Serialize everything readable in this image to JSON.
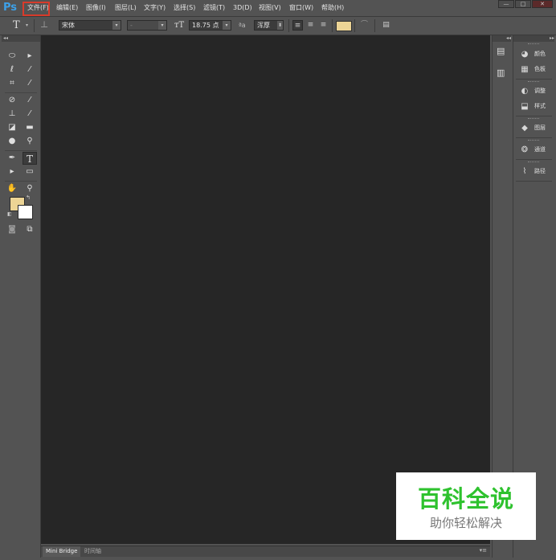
{
  "app": {
    "logo": "Ps"
  },
  "menu": [
    {
      "name": "menu-file",
      "label": "文件(F)"
    },
    {
      "name": "menu-edit",
      "label": "编辑(E)"
    },
    {
      "name": "menu-image",
      "label": "图像(I)"
    },
    {
      "name": "menu-layer",
      "label": "图层(L)"
    },
    {
      "name": "menu-type",
      "label": "文字(Y)"
    },
    {
      "name": "menu-select",
      "label": "选择(S)"
    },
    {
      "name": "menu-filter",
      "label": "滤镜(T)"
    },
    {
      "name": "menu-3d",
      "label": "3D(D)"
    },
    {
      "name": "menu-view",
      "label": "视图(V)"
    },
    {
      "name": "menu-window",
      "label": "窗口(W)"
    },
    {
      "name": "menu-help",
      "label": "帮助(H)"
    }
  ],
  "window_controls": {
    "minimize": "—",
    "maximize": "□",
    "close": "✕"
  },
  "options": {
    "font_family": "宋体",
    "font_style": "-",
    "font_size": "18.75 点",
    "antialias_label": "ªa",
    "antialias": "浑厚",
    "text_color": "#ecd495"
  },
  "tools": {
    "foreground_color": "#ecd495",
    "background_color": "#ffffff"
  },
  "canvas": {
    "background": "#262626"
  },
  "bottom_tabs": [
    {
      "label": "Mini Bridge"
    },
    {
      "label": "时间轴"
    }
  ],
  "panels": [
    {
      "name": "panel-color",
      "label": "颜色",
      "icon": "palette-icon"
    },
    {
      "name": "panel-swatches",
      "label": "色板",
      "icon": "swatches-icon"
    },
    {
      "name": "panel-adjustments",
      "label": "调整",
      "icon": "adjustments-icon"
    },
    {
      "name": "panel-styles",
      "label": "样式",
      "icon": "styles-icon"
    },
    {
      "name": "panel-layers",
      "label": "图层",
      "icon": "layers-icon"
    },
    {
      "name": "panel-channels",
      "label": "通道",
      "icon": "channels-icon"
    },
    {
      "name": "panel-paths",
      "label": "路径",
      "icon": "paths-icon"
    }
  ],
  "watermark": {
    "title": "百科全说",
    "subtitle": "助你轻松解决"
  }
}
